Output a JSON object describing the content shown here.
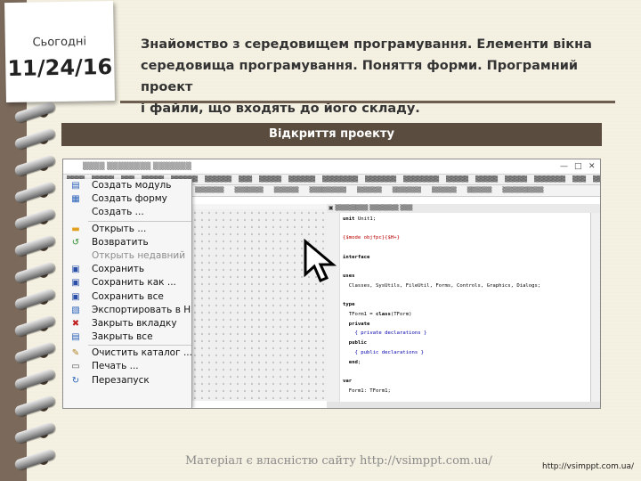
{
  "note": {
    "label": "Сьогодні",
    "date": "11/24/16"
  },
  "title": {
    "lines": [
      "Знайомство з середовищем програмування. Елементи вікна",
      "середовища програмування. Поняття форми. Програмний проект",
      "і файли, що входять до його складу."
    ]
  },
  "banner": {
    "text": "Відкриття проекту"
  },
  "ide": {
    "window_controls": [
      "—",
      "□",
      "✕"
    ],
    "file_menu": [
      {
        "label": "Создать модуль",
        "icon": "new-unit-icon",
        "disabled": false
      },
      {
        "label": "Создать форму",
        "icon": "new-form-icon",
        "disabled": false
      },
      {
        "label": "Создать ...",
        "icon": "none",
        "disabled": false
      },
      {
        "sep": true
      },
      {
        "label": "Открыть ...",
        "icon": "open-folder-icon",
        "disabled": false
      },
      {
        "label": "Возвратить",
        "icon": "revert-icon",
        "disabled": false
      },
      {
        "label": "Открыть недавний",
        "icon": "none",
        "disabled": true
      },
      {
        "label": "Сохранить",
        "icon": "save-icon",
        "disabled": false
      },
      {
        "label": "Сохранить как ...",
        "icon": "save-as-icon",
        "disabled": false
      },
      {
        "label": "Сохранить все",
        "icon": "save-all-icon",
        "disabled": false
      },
      {
        "label": "Экспортировать в H",
        "icon": "export-icon",
        "disabled": false
      },
      {
        "label": "Закрыть вкладку",
        "icon": "close-tab-icon",
        "disabled": false
      },
      {
        "label": "Закрыть все",
        "icon": "close-all-icon",
        "disabled": false
      },
      {
        "sep": true
      },
      {
        "label": "Очистить каталог ...",
        "icon": "clean-icon",
        "disabled": false
      },
      {
        "label": "Печать ...",
        "icon": "print-icon",
        "disabled": false
      },
      {
        "label": "Перезапуск",
        "icon": "restart-icon",
        "disabled": false
      }
    ]
  },
  "footer": {
    "watermark": "Матеріал є власністю сайту http://vsimppt.com.ua/",
    "url": "http://vsimppt.com.ua/"
  }
}
